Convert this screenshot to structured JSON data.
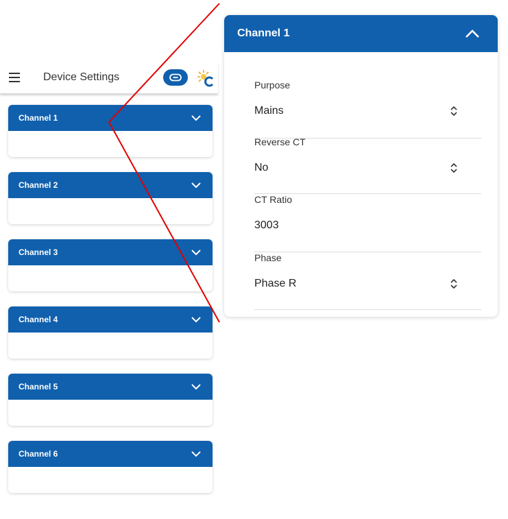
{
  "appbar": {
    "title": "Device Settings",
    "menu_icon": "hamburger-menu-icon",
    "link_icon": "link-icon",
    "logo_icon": "sun-logo-icon",
    "accent_color": "#1060ad"
  },
  "channels": [
    {
      "label": "Channel 1",
      "expanded": false
    },
    {
      "label": "Channel 2",
      "expanded": false
    },
    {
      "label": "Channel 3",
      "expanded": false
    },
    {
      "label": "Channel 4",
      "expanded": false
    },
    {
      "label": "Channel 5",
      "expanded": false
    },
    {
      "label": "Channel 6",
      "expanded": false
    }
  ],
  "detail": {
    "title": "Channel 1",
    "expanded": true,
    "fields": [
      {
        "label": "Purpose",
        "value": "Mains",
        "type": "select"
      },
      {
        "label": "Reverse CT",
        "value": "No",
        "type": "select"
      },
      {
        "label": "CT Ratio",
        "value": "3003",
        "type": "text"
      },
      {
        "label": "Phase",
        "value": "Phase R",
        "type": "select"
      }
    ]
  },
  "callout_color": "#e00000"
}
